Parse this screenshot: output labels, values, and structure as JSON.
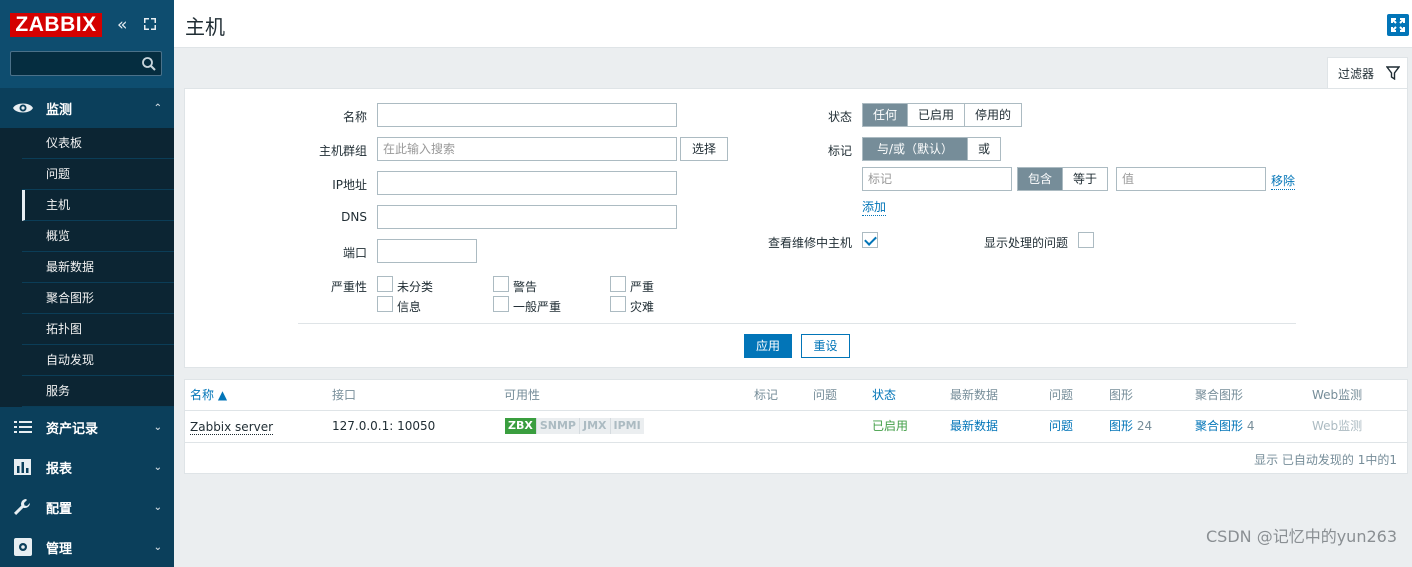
{
  "sidebar": {
    "logo": "ZABBIX",
    "monitoring": {
      "label": "监测",
      "items": [
        "仪表板",
        "问题",
        "主机",
        "概览",
        "最新数据",
        "聚合图形",
        "拓扑图",
        "自动发现",
        "服务"
      ]
    },
    "inventory": "资产记录",
    "reports": "报表",
    "config": "配置",
    "admin": "管理"
  },
  "header": {
    "title": "主机"
  },
  "filter_tab": {
    "label": "过滤器"
  },
  "filter": {
    "name_label": "名称",
    "hostgroup_label": "主机群组",
    "hostgroup_placeholder": "在此输入搜索",
    "select_btn": "选择",
    "ip_label": "IP地址",
    "dns_label": "DNS",
    "port_label": "端口",
    "severity_label": "严重性",
    "severities": [
      "未分类",
      "警告",
      "严重",
      "信息",
      "一般严重",
      "灾难"
    ],
    "status_label": "状态",
    "status_options": [
      "任何",
      "已启用",
      "停用的"
    ],
    "tags_label": "标记",
    "tag_mode_options": [
      "与/或（默认）",
      "或"
    ],
    "tag_placeholder": "标记",
    "tag_op_options": [
      "包含",
      "等于"
    ],
    "value_placeholder": "值",
    "remove_link": "移除",
    "add_link": "添加",
    "maintenance_label": "查看维修中主机",
    "show_suppressed_label": "显示处理的问题",
    "apply_btn": "应用",
    "reset_btn": "重设"
  },
  "table": {
    "headers": [
      "名称 ▲",
      "接口",
      "可用性",
      "标记",
      "问题",
      "状态",
      "最新数据",
      "问题",
      "图形",
      "聚合图形",
      "Web监测"
    ],
    "row": {
      "name": "Zabbix server",
      "interface": "127.0.0.1: 10050",
      "availability": [
        "ZBX",
        "SNMP",
        "JMX",
        "IPMI"
      ],
      "status": "已启用",
      "latest": "最新数据",
      "problems": "问题",
      "graphs": "图形",
      "graphs_count": "24",
      "screens": "聚合图形",
      "screens_count": "4",
      "web": "Web监测"
    },
    "footer": "显示 已自动发现的 1中的1"
  },
  "watermark": "CSDN @记忆中的yun263",
  "colors": {
    "sidebar": "#0e4d6f",
    "accent": "#0275b8",
    "logo": "#d40000",
    "zbx": "#3a9e3f"
  }
}
